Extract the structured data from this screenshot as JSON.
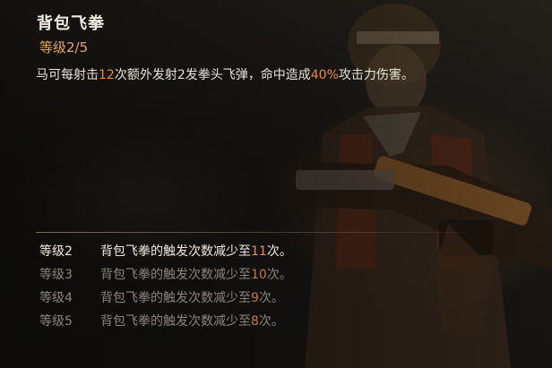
{
  "skill": {
    "name": "背包飞拳",
    "level_label": "等级2/5",
    "description": {
      "before": "马可每射击",
      "num1": "12",
      "middle": "次额外发射2发拳头飞弹，命中造成",
      "num2": "40%",
      "after": "攻击力伤害。"
    }
  },
  "upgrades": [
    {
      "level": "等级2",
      "text": "背包飞拳的触发次数减少至",
      "value": "11",
      "suffix": "次。",
      "active": true
    },
    {
      "level": "等级3",
      "text": "背包飞拳的触发次数减少至",
      "value": "10",
      "suffix": "次。",
      "active": false
    },
    {
      "level": "等级4",
      "text": "背包飞拳的触发次数减少至",
      "value": "9",
      "suffix": "次。",
      "active": false
    },
    {
      "level": "等级5",
      "text": "背包飞拳的触发次数减少至",
      "value": "8",
      "suffix": "次。",
      "active": false
    }
  ],
  "colors": {
    "accent": "#f08c28",
    "level_label": "#e8a84a",
    "text": "#e8e2d6",
    "dim_text": "#8a847a"
  }
}
